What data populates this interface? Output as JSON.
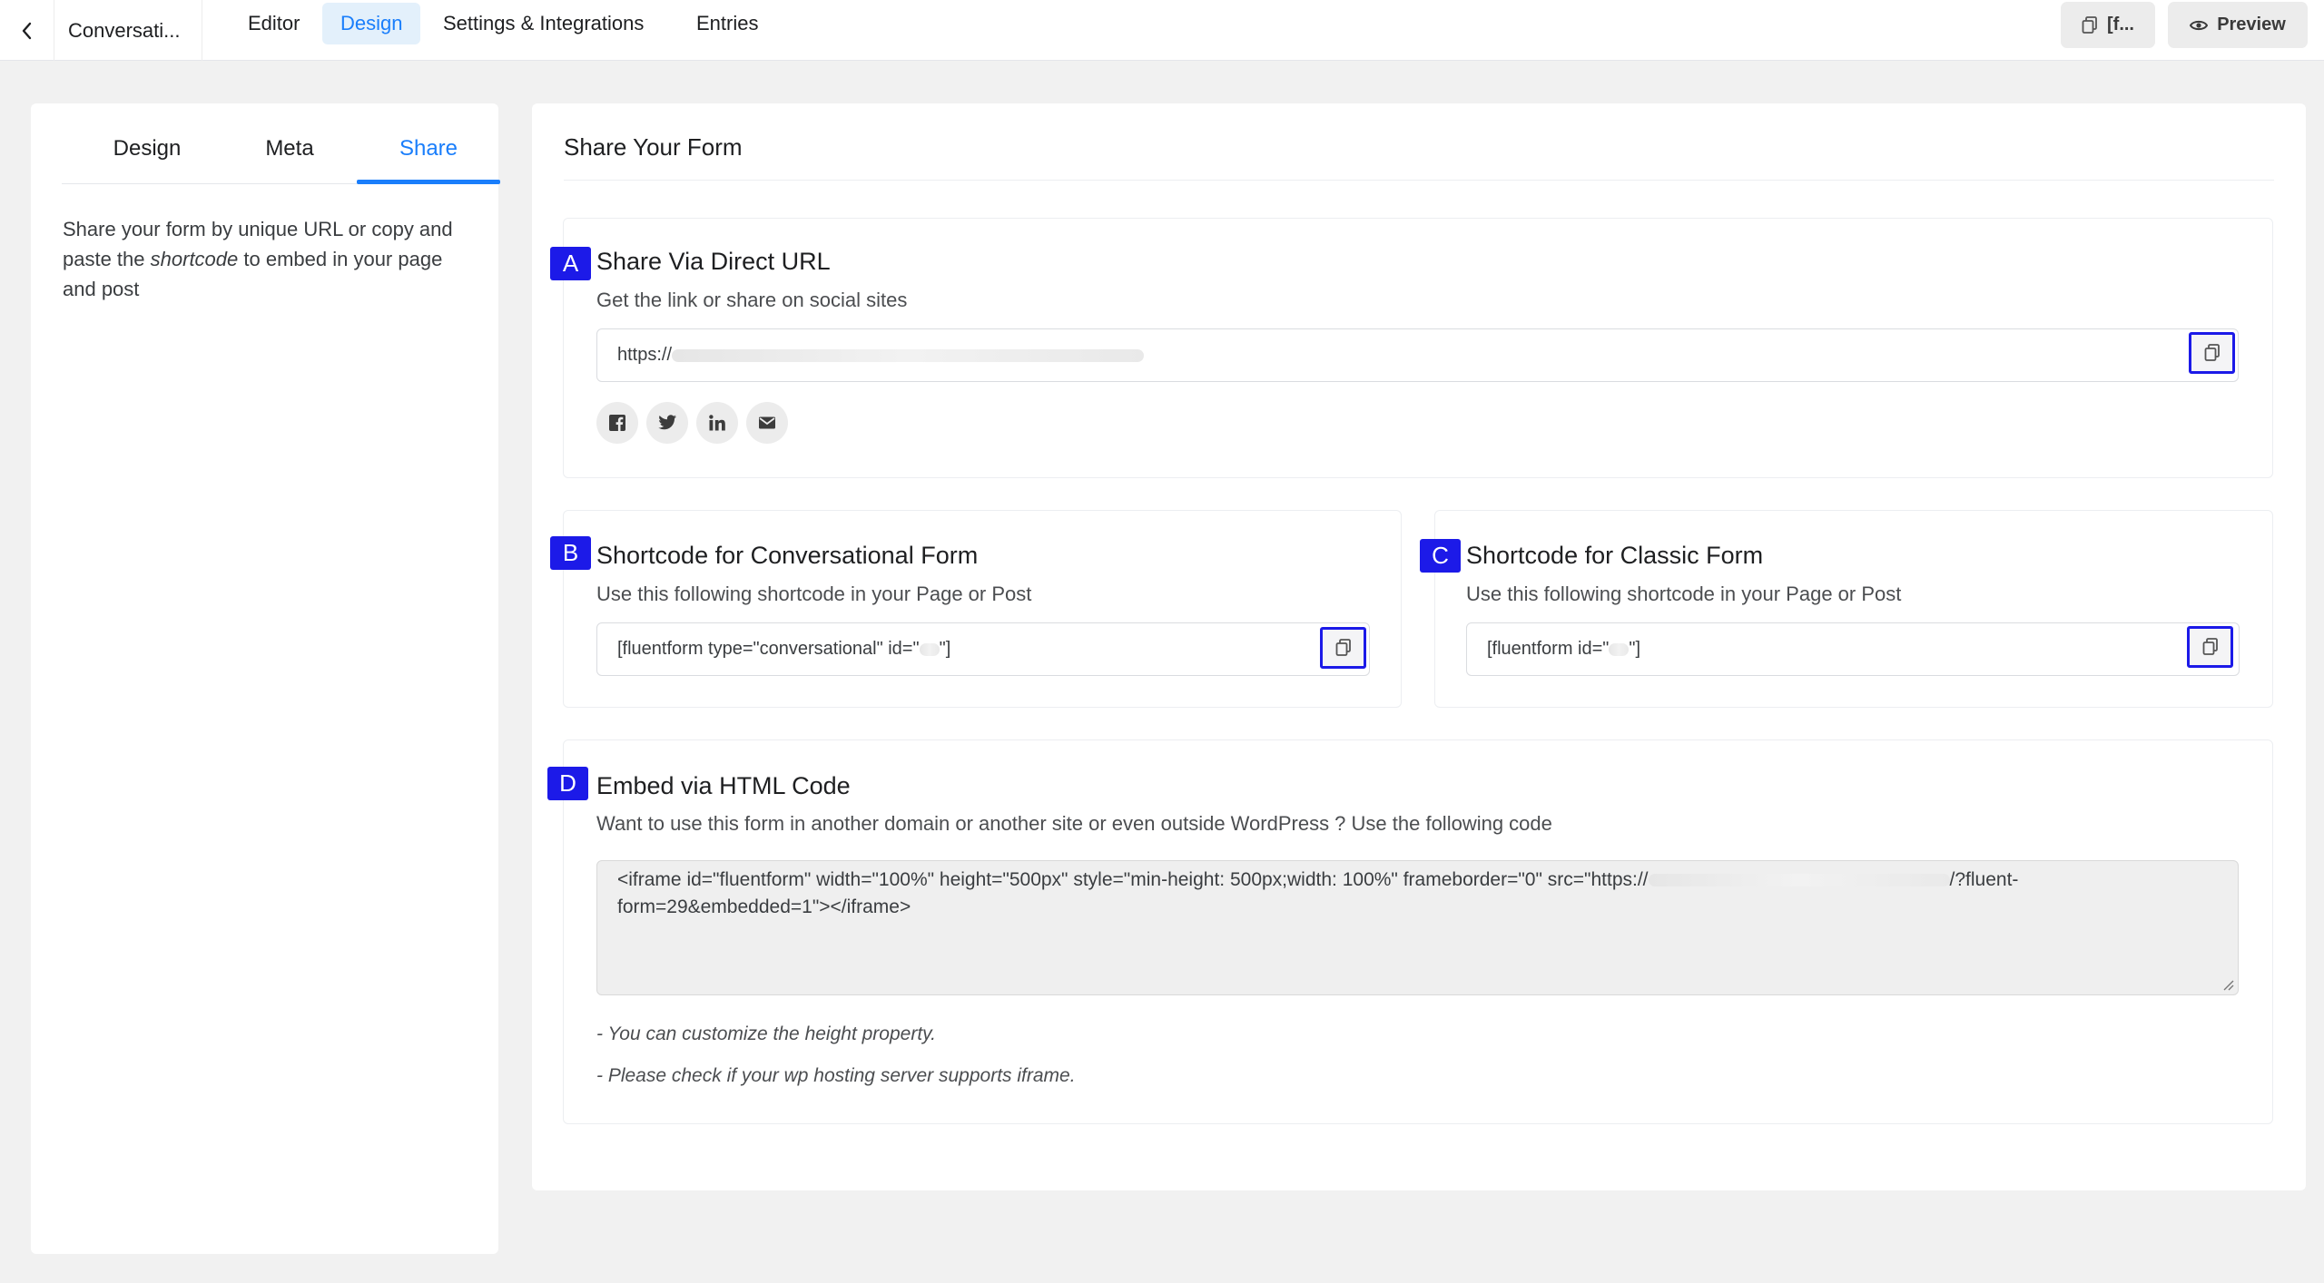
{
  "topbar": {
    "form_name": "Conversati...",
    "tabs": [
      {
        "label": "Editor"
      },
      {
        "label": "Design"
      },
      {
        "label": "Settings & Integrations"
      },
      {
        "label": "Entries"
      }
    ],
    "shortcode_button_label": "[f...",
    "preview_button_label": "Preview"
  },
  "sidebar": {
    "tabs": [
      {
        "label": "Design"
      },
      {
        "label": "Meta"
      },
      {
        "label": "Share"
      }
    ],
    "active_tab": "Share",
    "description_before": "Share your form by unique URL or copy and paste the ",
    "description_em": "shortcode",
    "description_after": " to embed in your page and post"
  },
  "main": {
    "title": "Share Your Form",
    "direct_url": {
      "marker": "A",
      "title": "Share Via Direct URL",
      "subtitle": "Get the link or share on social sites",
      "url_prefix": "https://",
      "social_icons": [
        "facebook-icon",
        "twitter-icon",
        "linkedin-icon",
        "email-icon"
      ]
    },
    "conversational_shortcode": {
      "marker": "B",
      "title": "Shortcode for Conversational Form",
      "subtitle": "Use this following shortcode in your Page or Post",
      "code_start": "[fluentform type=\"conversational\" id=\"",
      "code_end": "\"]"
    },
    "classic_shortcode": {
      "marker": "C",
      "title": "Shortcode for Classic Form",
      "subtitle": "Use this following shortcode in your Page or Post",
      "code_start": "[fluentform id=\"",
      "code_end": "\"]"
    },
    "embed_html": {
      "marker": "D",
      "title": "Embed via HTML Code",
      "subtitle": "Want to use this form in another domain or another site or even outside WordPress ? Use the following code",
      "code_start": "<iframe id=\"fluentform\" width=\"100%\" height=\"500px\" style=\"min-height: 500px;width: 100%\" frameborder=\"0\" src=\"https://",
      "code_end": "/?fluent-form=29&embedded=1\"></iframe>",
      "notes": [
        "- You can customize the height property.",
        "- Please check if your wp hosting server supports iframe."
      ]
    }
  },
  "colors": {
    "accent": "#1a7efb",
    "marker": "#1c1ae8",
    "background": "#f1f1f1"
  }
}
